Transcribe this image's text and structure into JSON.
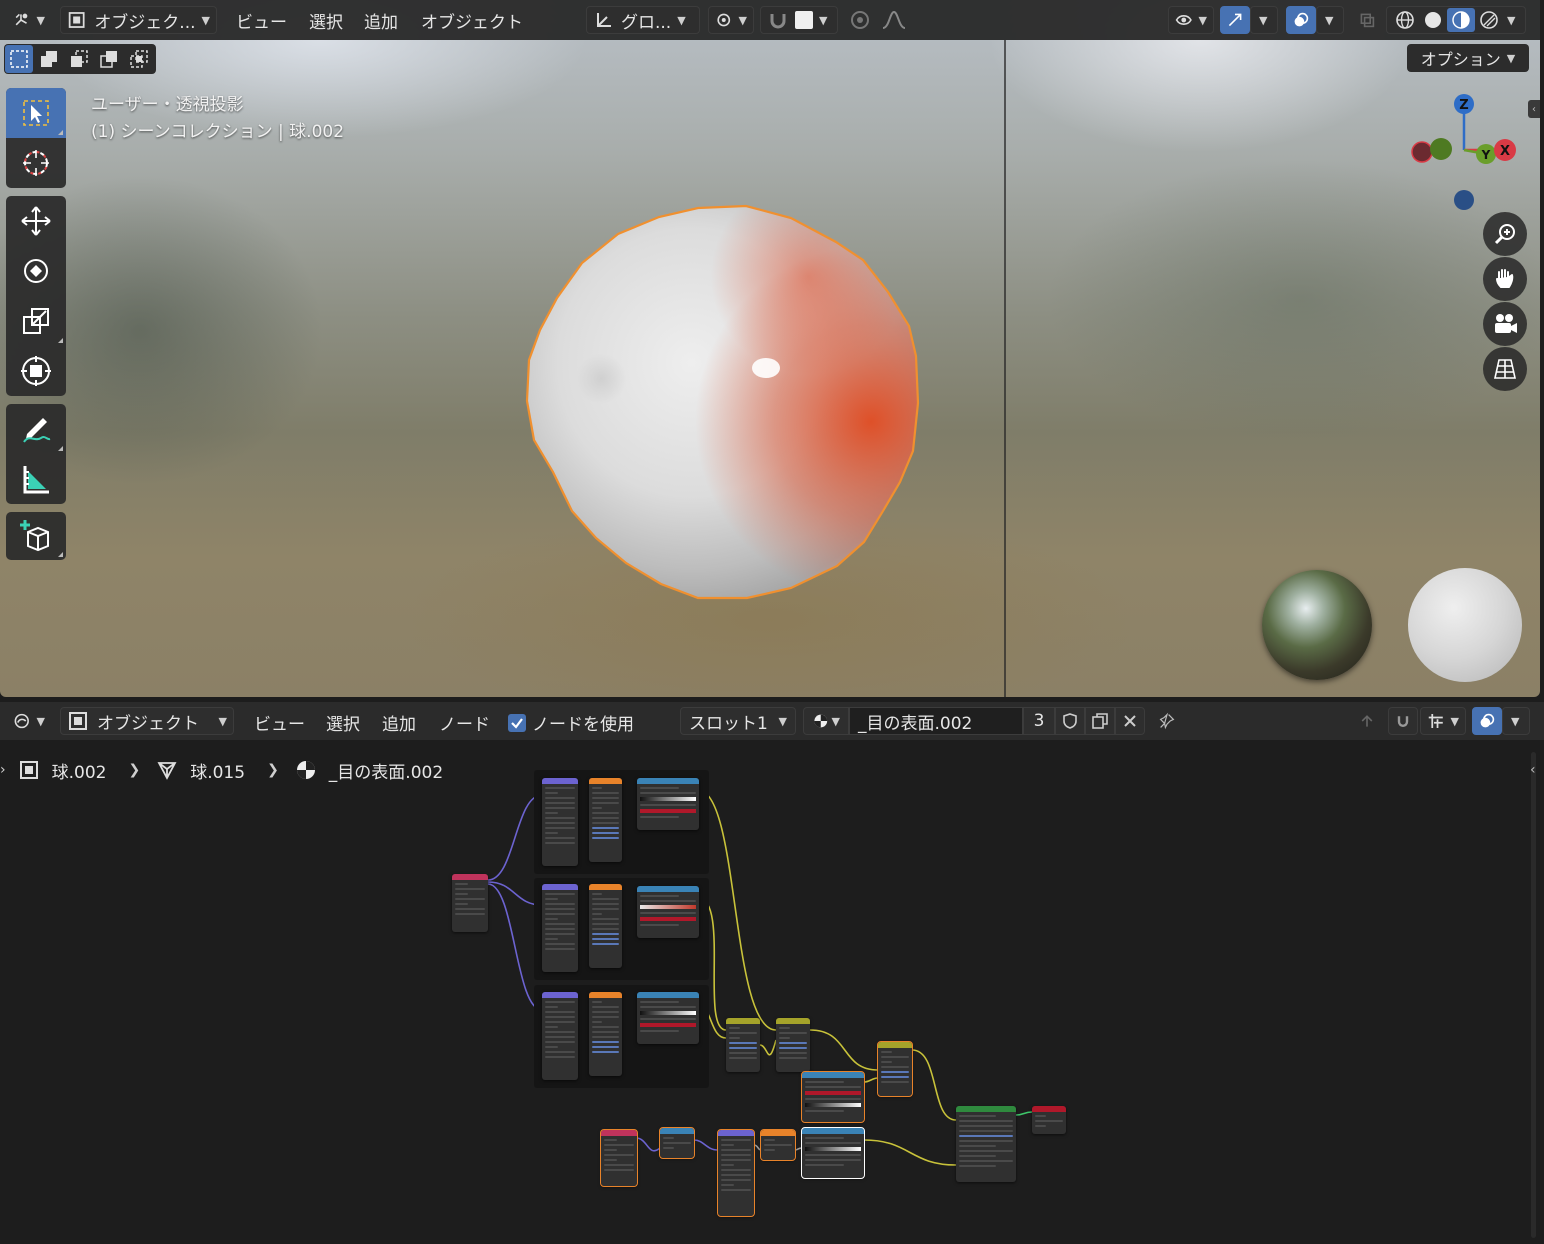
{
  "viewport": {
    "header": {
      "mode_label": "オブジェク...",
      "menus": [
        "ビュー",
        "選択",
        "追加",
        "オブジェクト"
      ],
      "transform_orientation": "グロ...",
      "options_label": "オプション"
    },
    "overlay": {
      "view_name": "ユーザー・透視投影",
      "collection_info": "(1) シーンコレクション | 球.002"
    },
    "gizmo": {
      "z": "Z",
      "x": "X",
      "y": "Y"
    },
    "colors": {
      "accent": "#4772b3",
      "selection_outline": "#f0902f",
      "x_axis": "#d93a45",
      "y_axis": "#6a9e2b",
      "z_axis": "#2e6dc7"
    }
  },
  "node_editor": {
    "header": {
      "mode_label": "オブジェクト",
      "menus": [
        "ビュー",
        "選択",
        "追加",
        "ノード"
      ],
      "use_nodes_label": "ノードを使用",
      "use_nodes_checked": true,
      "slot_label": "スロット1",
      "material_name": "_目の表面.002",
      "user_count": "3"
    },
    "breadcrumb": [
      {
        "label": "球.002",
        "icon": "object-icon"
      },
      {
        "label": "球.015",
        "icon": "mesh-icon"
      },
      {
        "label": "_目の表面.002",
        "icon": "material-icon"
      }
    ]
  }
}
